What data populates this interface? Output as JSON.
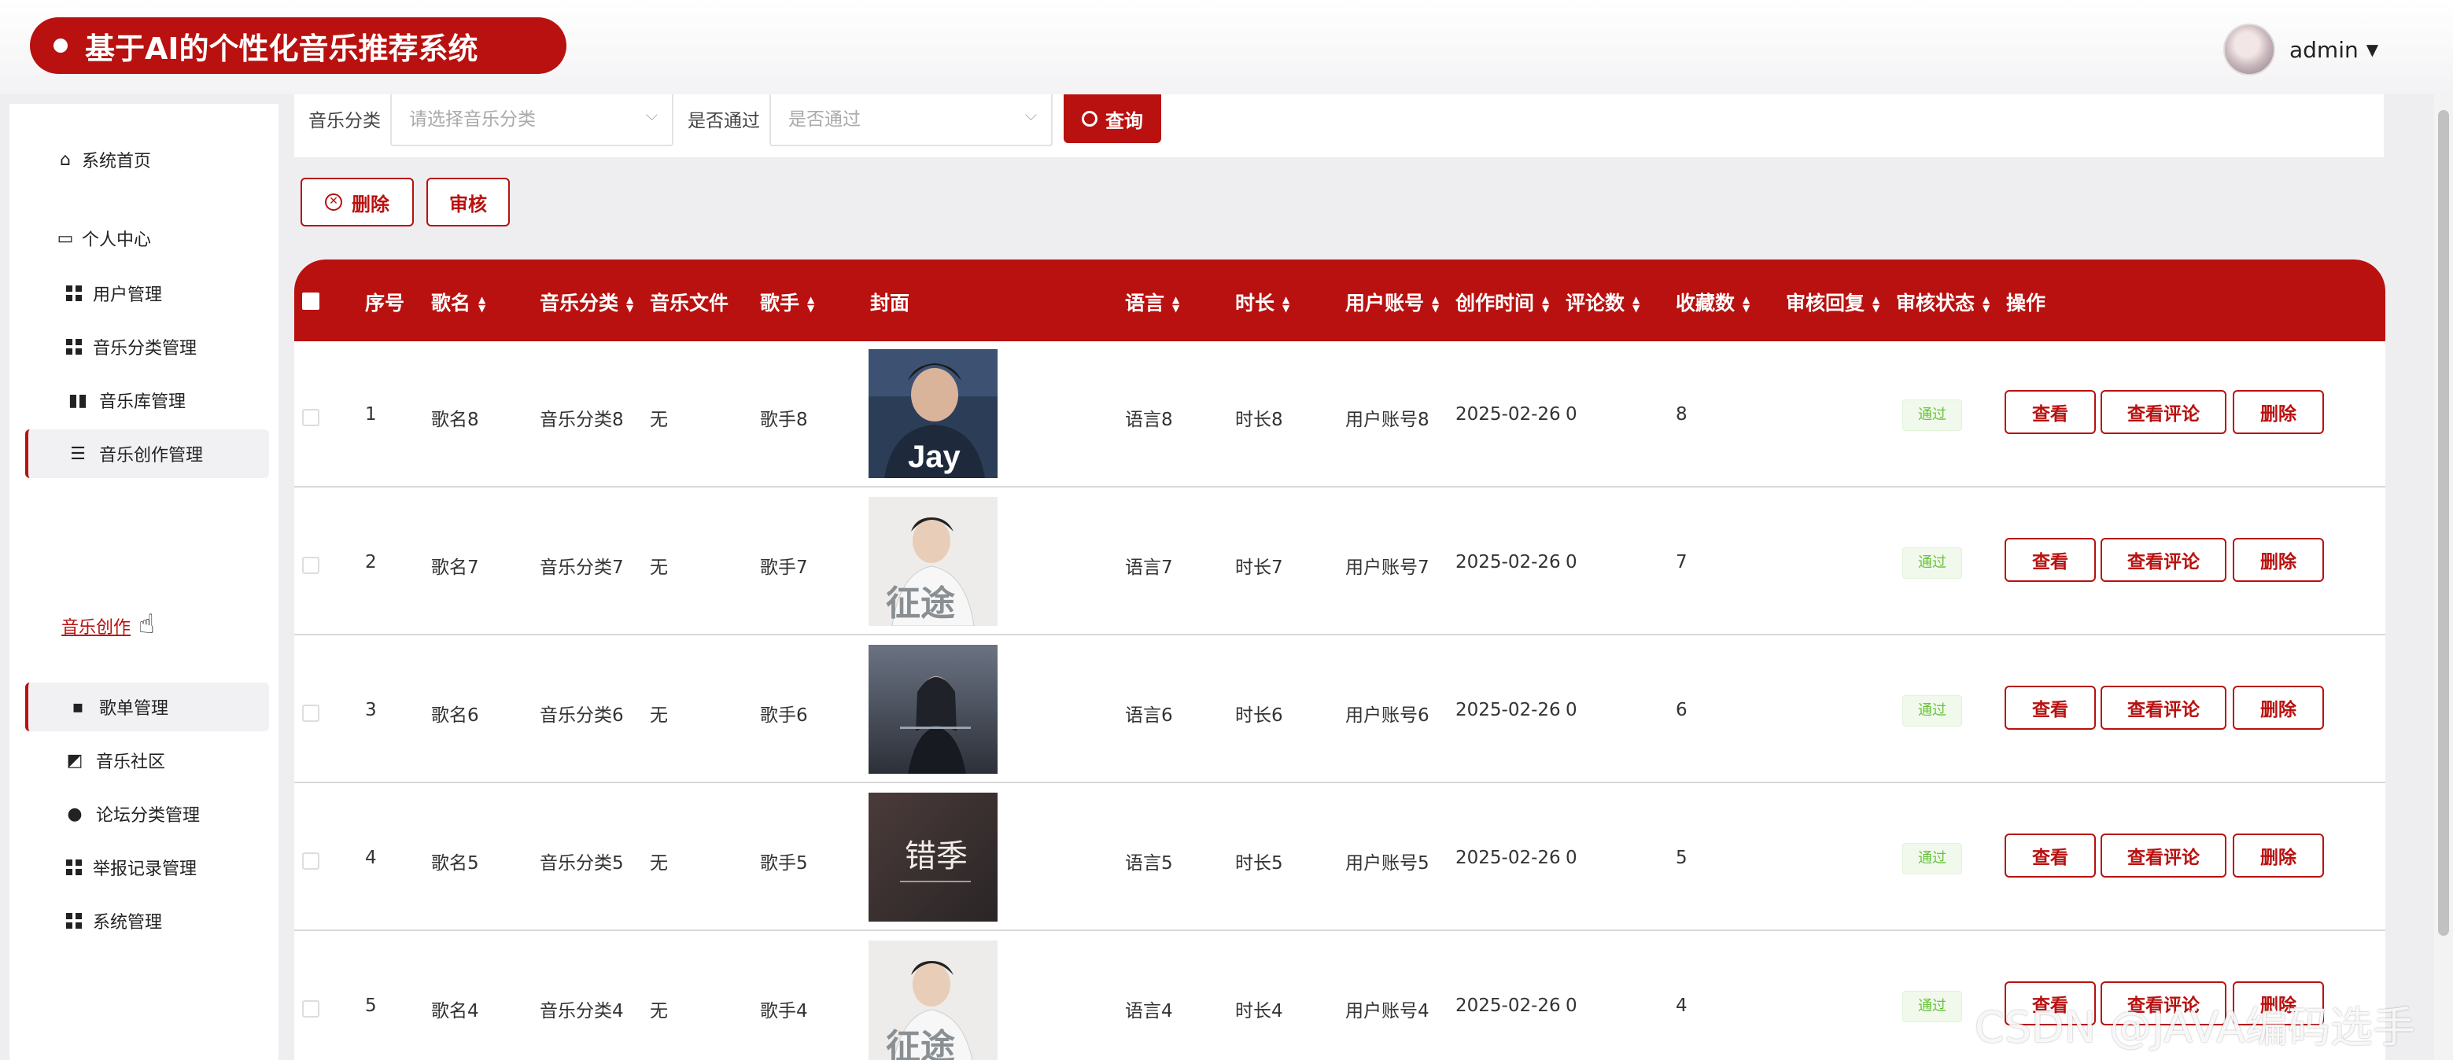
{
  "header": {
    "title": "基于AI的个性化音乐推荐系统",
    "username": "admin",
    "caret": "▼"
  },
  "sidebar": {
    "items": [
      {
        "label": "系统首页",
        "icon": "home-icon"
      },
      {
        "label": "个人中心",
        "icon": "card-icon"
      },
      {
        "label": "用户管理",
        "icon": "grid-icon"
      },
      {
        "label": "音乐分类管理",
        "icon": "grid-icon"
      },
      {
        "label": "音乐库管理",
        "icon": "library-icon"
      },
      {
        "label": "音乐创作管理",
        "icon": "list-icon"
      },
      {
        "label": "歌单管理",
        "icon": "chat-icon"
      },
      {
        "label": "音乐社区",
        "icon": "chart-icon"
      },
      {
        "label": "论坛分类管理",
        "icon": "user-icon"
      },
      {
        "label": "举报记录管理",
        "icon": "grid-icon"
      },
      {
        "label": "系统管理",
        "icon": "grid-icon"
      }
    ],
    "sub_link": "音乐创作"
  },
  "search": {
    "category_label": "音乐分类",
    "category_placeholder": "请选择音乐分类",
    "approve_label": "是否通过",
    "approve_placeholder": "是否通过",
    "query_button": "查询"
  },
  "toolbar": {
    "delete_label": "删除",
    "audit_label": "审核"
  },
  "table": {
    "columns": [
      "序号",
      "歌名",
      "音乐分类",
      "音乐文件",
      "歌手",
      "封面",
      "语言",
      "时长",
      "用户账号",
      "创作时间",
      "评论数",
      "收藏数",
      "审核回复",
      "审核状态",
      "操作"
    ],
    "rows": [
      {
        "no": "1",
        "name": "歌名8",
        "category": "音乐分类8",
        "file": "无",
        "singer": "歌手8",
        "cover_text": "Jay",
        "language": "语言8",
        "duration": "时长8",
        "account": "用户账号8",
        "created": "2025-02-26",
        "comments": "0",
        "favorites": "8",
        "status": "通过"
      },
      {
        "no": "2",
        "name": "歌名7",
        "category": "音乐分类7",
        "file": "无",
        "singer": "歌手7",
        "cover_text": "征途",
        "language": "语言7",
        "duration": "时长7",
        "account": "用户账号7",
        "created": "2025-02-26",
        "comments": "0",
        "favorites": "7",
        "status": "通过"
      },
      {
        "no": "3",
        "name": "歌名6",
        "category": "音乐分类6",
        "file": "无",
        "singer": "歌手6",
        "cover_text": "",
        "language": "语言6",
        "duration": "时长6",
        "account": "用户账号6",
        "created": "2025-02-26",
        "comments": "0",
        "favorites": "6",
        "status": "通过"
      },
      {
        "no": "4",
        "name": "歌名5",
        "category": "音乐分类5",
        "file": "无",
        "singer": "歌手5",
        "cover_text": "错季",
        "language": "语言5",
        "duration": "时长5",
        "account": "用户账号5",
        "created": "2025-02-26",
        "comments": "0",
        "favorites": "5",
        "status": "通过"
      },
      {
        "no": "5",
        "name": "歌名4",
        "category": "音乐分类4",
        "file": "无",
        "singer": "歌手4",
        "cover_text": "征途",
        "language": "语言4",
        "duration": "时长4",
        "account": "用户账号4",
        "created": "2025-02-26",
        "comments": "0",
        "favorites": "4",
        "status": "通过"
      }
    ],
    "actions": {
      "view": "查看",
      "view_comments": "查看评论",
      "delete": "删除"
    }
  },
  "watermark": "CSDN @JAVA编码选手",
  "colors": {
    "accent": "#b8110f",
    "success": "#67c23a",
    "background": "#eeeef0"
  }
}
